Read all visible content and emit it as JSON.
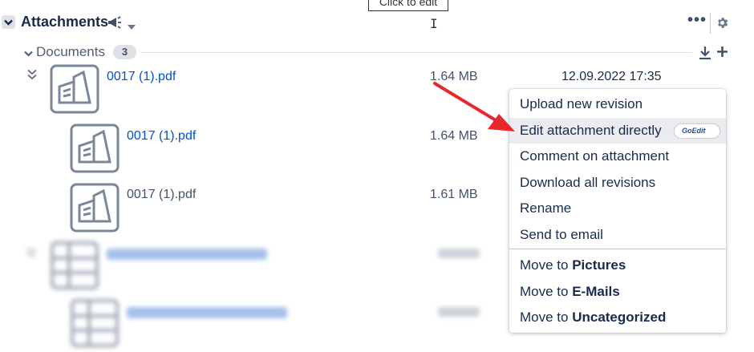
{
  "tooltip": "Click to edit",
  "header": {
    "title": "Attachments",
    "more_label": "•••"
  },
  "group": {
    "label": "Documents",
    "count": "3"
  },
  "files": [
    {
      "name": "0017 (1).pdf",
      "size": "1.64 MB",
      "date": "12.09.2022 17:35"
    },
    {
      "name": "0017 (1).pdf",
      "size": "1.64 MB"
    },
    {
      "name": "0017 (1).pdf",
      "size": "1.61 MB"
    }
  ],
  "context_menu": {
    "items": [
      {
        "label": "Upload new revision"
      },
      {
        "label": "Edit attachment directly",
        "badge": "GoEdit"
      },
      {
        "label": "Comment on attachment"
      },
      {
        "label": "Download all revisions"
      },
      {
        "label": "Rename"
      },
      {
        "label": "Send to email"
      }
    ],
    "move_prefix": "Move to ",
    "move_targets": [
      "Pictures",
      "E-Mails",
      "Uncategorized"
    ]
  },
  "colors": {
    "link": "#0052cc",
    "arrow": "#e8272b",
    "icon": "#7a869a"
  }
}
